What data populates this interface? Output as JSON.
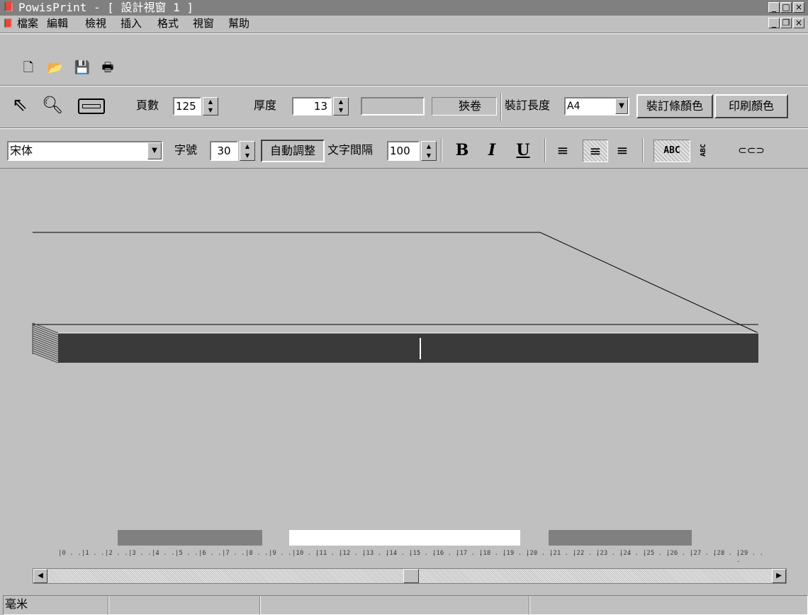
{
  "window": {
    "title": "PowisPrint  - [  設計視窗 1  ]",
    "app_icon": "book-icon"
  },
  "menu": [
    "檔案",
    "編輯",
    "檢視",
    "插入",
    "格式",
    "視窗",
    "幫助"
  ],
  "toolbar_standard": {
    "icons": [
      "new-document-icon",
      "open-folder-icon",
      "save-disk-icon",
      "print-icon"
    ]
  },
  "toolbar_design": {
    "pages_label": "頁數",
    "pages_value": "125",
    "thickness_label": "厚度",
    "thickness_value": "13",
    "blank_field": "",
    "narrow_roll": "狹卷",
    "binding_length_label": "裝訂長度",
    "binding_length_value": "A4",
    "binding_strip_color": "裝訂條顏色",
    "print_color": "印刷顏色"
  },
  "toolbar_format": {
    "font_name": "宋体",
    "font_size_label": "字號",
    "font_size_value": "30",
    "auto_adjust": "自動調整",
    "char_spacing_label": "文字間隔",
    "char_spacing_value": "100",
    "bold": "B",
    "italic": "I",
    "underline": "U",
    "text_mode_horizontal": "ABC"
  },
  "ruler": {
    "numbers": [
      "0",
      "1",
      "2",
      "3",
      "4",
      "5",
      "6",
      "7",
      "8",
      "9",
      "10",
      "11",
      "12",
      "13",
      "14",
      "15",
      "16",
      "17",
      "18",
      "19",
      "20",
      "21",
      "22",
      "23",
      "24",
      "25",
      "26",
      "27",
      "28",
      "29"
    ]
  },
  "status": {
    "unit": "毫米"
  },
  "colors": {
    "spine": "#3a3a3a",
    "bars_gray": "#808080",
    "bar_white": "#ffffff"
  }
}
